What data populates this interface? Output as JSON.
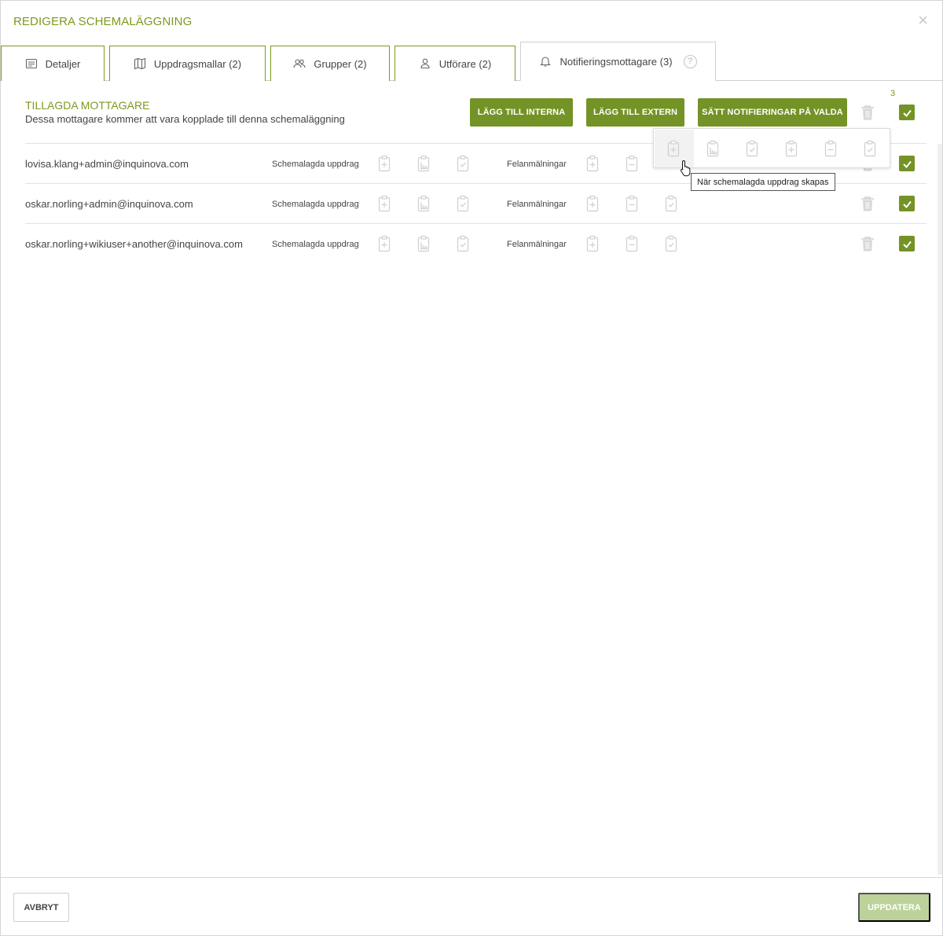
{
  "dialog": {
    "title": "REDIGERA SCHEMALÄGGNING",
    "close_label": "×"
  },
  "tabs": [
    {
      "label": "Detaljer",
      "icon": "list-icon"
    },
    {
      "label": "Uppdragsmallar (2)",
      "icon": "map-icon"
    },
    {
      "label": "Grupper (2)",
      "icon": "users-icon"
    },
    {
      "label": "Utförare (2)",
      "icon": "user-icon"
    },
    {
      "label": "Notifieringsmottagare (3)",
      "icon": "bell-icon",
      "active": true,
      "help": "?"
    }
  ],
  "section": {
    "title": "TILLAGDA MOTTAGARE",
    "subtitle": "Dessa mottagare kommer att vara kopplade till denna schemaläggning"
  },
  "actions": {
    "add_internal": "LÄGG TILL INTERNA",
    "add_external": "LÄGG TILL EXTERN",
    "set_notifications": "SÄTT NOTIFIERINGAR PÅ VALDA",
    "selected_count": "3"
  },
  "recipients": [
    {
      "email": "lovisa.klang+admin@inquinova.com",
      "group_scheduled": "Schemalagda uppdrag",
      "group_faults": "Felanmälningar"
    },
    {
      "email": "oskar.norling+admin@inquinova.com",
      "group_scheduled": "Schemalagda uppdrag",
      "group_faults": "Felanmälningar"
    },
    {
      "email": "oskar.norling+wikiuser+another@inquinova.com",
      "group_scheduled": "Schemalagda uppdrag",
      "group_faults": "Felanmälningar"
    }
  ],
  "tooltip": "När schemalagda uppdrag skapas",
  "footer": {
    "cancel": "AVBRYT",
    "update": "UPPDATERA"
  },
  "colors": {
    "accent": "#739326",
    "title": "#7a9a1e",
    "disabled": "#bcd29a"
  }
}
